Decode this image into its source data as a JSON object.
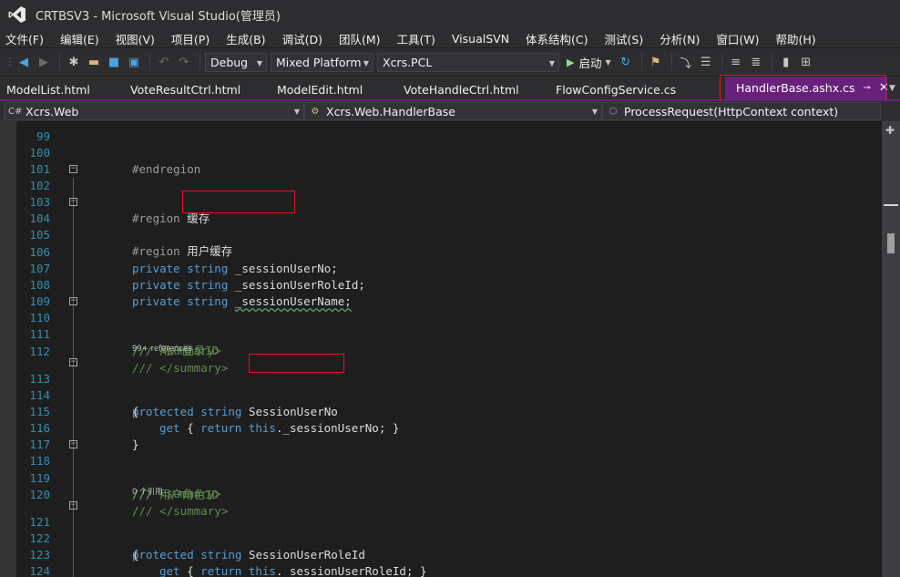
{
  "window": {
    "title": "CRTBSV3 - Microsoft Visual Studio(管理员)"
  },
  "menu": [
    "文件(F)",
    "编辑(E)",
    "视图(V)",
    "项目(P)",
    "生成(B)",
    "调试(D)",
    "团队(M)",
    "工具(T)",
    "VisualSVN",
    "体系结构(C)",
    "测试(S)",
    "分析(N)",
    "窗口(W)",
    "帮助(H)"
  ],
  "toolbar": {
    "configuration": "Debug",
    "platform": "Mixed Platform",
    "project": "Xcrs.PCL",
    "start_label": "启动"
  },
  "tabs": [
    "ModelList.html",
    "VoteResultCtrl.html",
    "ModelEdit.html",
    "VoteHandleCtrl.html",
    "FlowConfigService.cs"
  ],
  "active_tab": "HandlerBase.ashx.cs",
  "navbar": {
    "project": "Xcrs.Web",
    "class": "Xcrs.Web.HandlerBase",
    "member": "ProcessRequest(HttpContext context)"
  },
  "code": {
    "top_partial_number": "99",
    "lines": [
      {
        "n": "100",
        "text": "#endregion"
      },
      {
        "n": "101",
        "text": ""
      },
      {
        "n": "102",
        "kw": "#region",
        "rest": " 缓存"
      },
      {
        "n": "103",
        "text": ""
      },
      {
        "n": "104",
        "kw": "#region",
        "rest": "用户缓存"
      },
      {
        "n": "105",
        "text": ""
      },
      {
        "n": "106",
        "kw": "private string",
        "rest": " _sessionUserNo;"
      },
      {
        "n": "107",
        "kw": "private string",
        "rest": " _sessionUserRoleId;"
      },
      {
        "n": "108",
        "kw": "private string",
        "rest": "_sessionUserName;"
      },
      {
        "n": "109",
        "text": ""
      },
      {
        "n": "110",
        "comment": "/// <summary>"
      },
      {
        "n": "111",
        "comment": "/// 用户登录ID"
      },
      {
        "n": "112",
        "comment": "/// </summary>"
      },
      {
        "n": "113",
        "kw": "protected string",
        "rest": "SessionUserNo"
      },
      {
        "n": "114",
        "text": "{"
      },
      {
        "n": "115",
        "get": "get",
        "brace": " { ",
        "ret": "return",
        "this": " this",
        "rest": "._sessionUserNo; }"
      },
      {
        "n": "116",
        "text": "}"
      },
      {
        "n": "117",
        "text": ""
      },
      {
        "n": "118",
        "comment": "/// <summary>"
      },
      {
        "n": "119",
        "comment": "/// 用户角色ID"
      },
      {
        "n": "120",
        "comment": "/// </summary>"
      },
      {
        "n": "121",
        "kw": "protected string",
        "rest": " SessionUserRoleId"
      },
      {
        "n": "122",
        "text": "{"
      },
      {
        "n": "123",
        "get": "get",
        "brace": " { ",
        "ret": "return",
        "this": " this",
        "rest": "._sessionUserRoleId; }"
      },
      {
        "n": "124",
        "text": "}"
      },
      {
        "n": "125",
        "text": ""
      }
    ],
    "codelens": {
      "refs_113": "99+ references",
      "refs_121": "0 个引用"
    }
  }
}
